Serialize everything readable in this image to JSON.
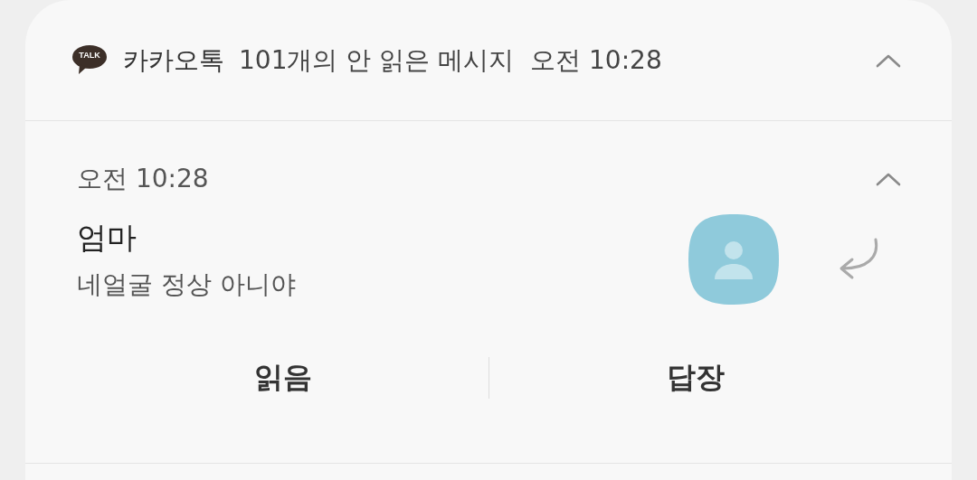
{
  "header": {
    "logo_text": "TALK",
    "app_name": "카카오톡",
    "summary": "101개의 안 읽은 메시지",
    "time": "오전 10:28",
    "expanded": true
  },
  "message": {
    "time": "오전 10:28",
    "expanded": true,
    "sender": "엄마",
    "text": "네얼굴 정상 아니야"
  },
  "actions": [
    {
      "label": "읽음"
    },
    {
      "label": "답장"
    }
  ]
}
